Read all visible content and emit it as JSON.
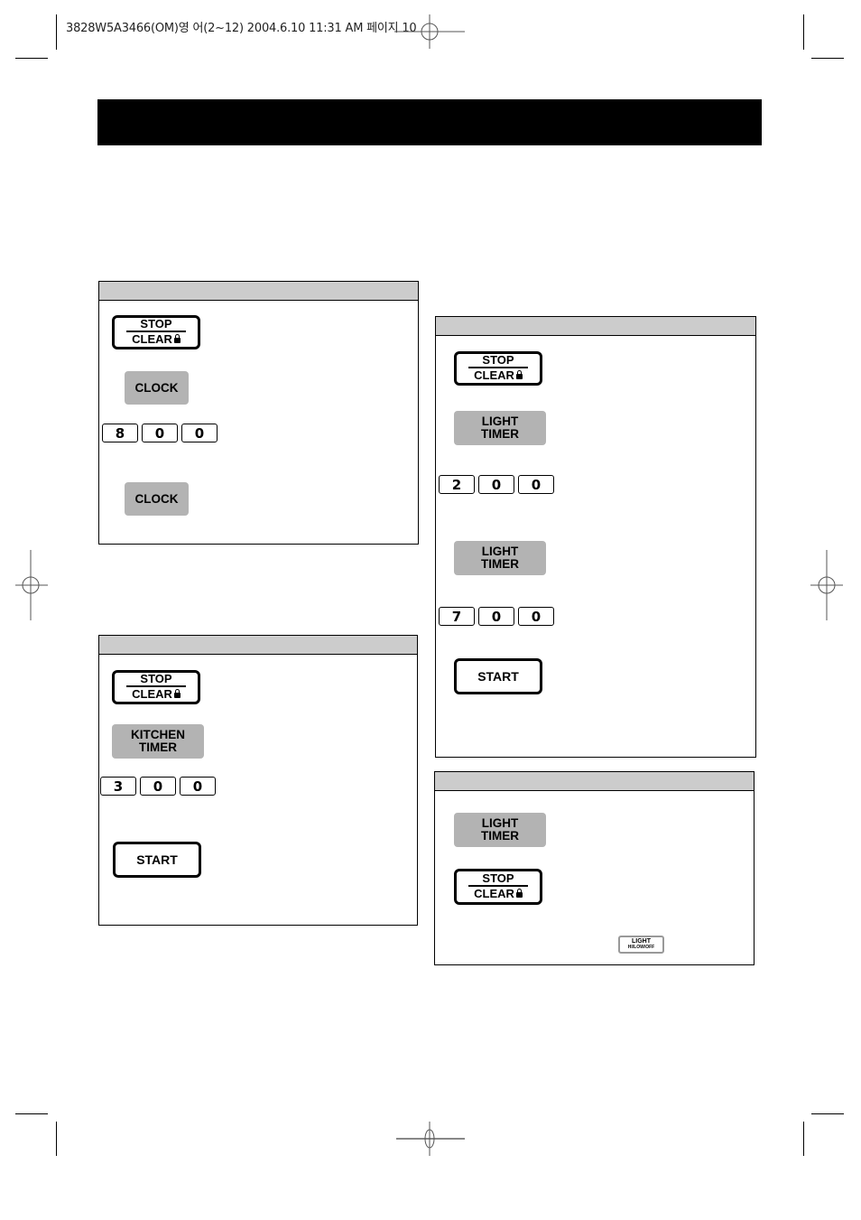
{
  "print_slug": "3828W5A3466(OM)영 어(2~12)  2004.6.10 11:31 AM 페이지 10",
  "buttons": {
    "stop": "STOP",
    "clear": "CLEAR",
    "clock": "CLOCK",
    "kitchen_timer_line1": "KITCHEN",
    "kitchen_timer_line2": "TIMER",
    "light_timer_line1": "LIGHT",
    "light_timer_line2": "TIMER",
    "start": "START",
    "light_small_line1": "LIGHT",
    "light_small_line2": "HI/LOW/OFF"
  },
  "panels": {
    "clock_setting": {
      "digits": [
        "8",
        "0",
        "0"
      ]
    },
    "kitchen_timer": {
      "digits": [
        "3",
        "0",
        "0"
      ]
    },
    "light_timer_set": {
      "digits_on": [
        "2",
        "0",
        "0"
      ],
      "digits_off": [
        "7",
        "0",
        "0"
      ]
    },
    "light_timer_cancel": {}
  },
  "colors": {
    "header_bar": "#000000",
    "panel_header": "#cccccc",
    "grey_button": "#b3b3b3"
  }
}
